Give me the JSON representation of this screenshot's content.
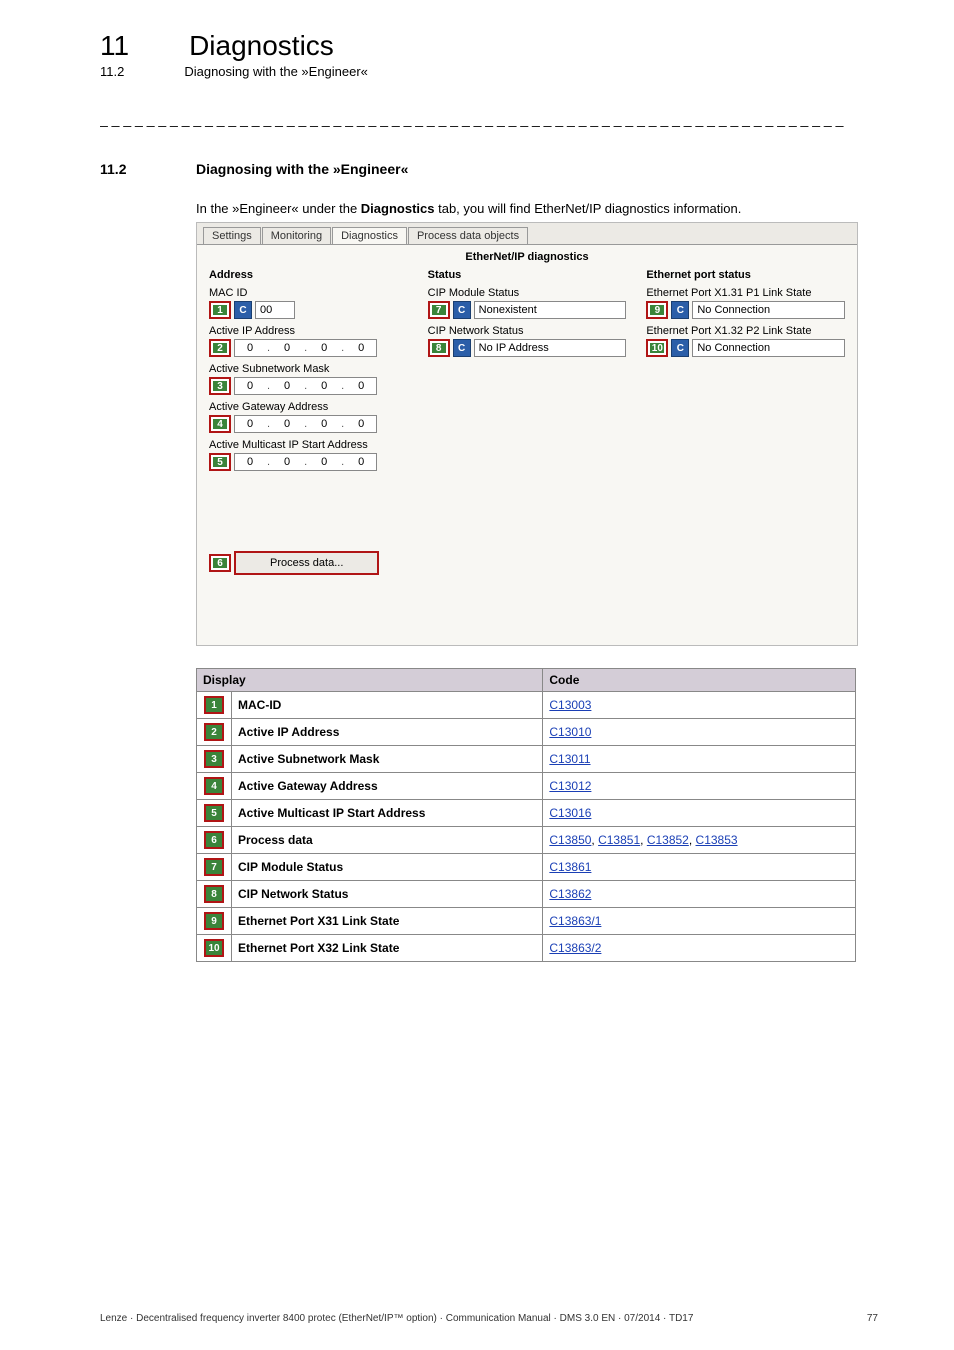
{
  "chapter": {
    "num": "11",
    "title": "Diagnostics"
  },
  "section": {
    "num": "11.2",
    "name": "Diagnosing with the »Engineer«"
  },
  "dashline": "_ _ _ _ _ _ _ _ _ _ _ _ _ _ _ _ _ _ _ _ _ _ _ _ _ _ _ _ _ _ _ _ _ _ _ _ _ _ _ _ _ _ _ _ _ _ _ _ _ _ _ _ _ _ _ _ _ _ _ _ _ _ _ _",
  "heading": {
    "num": "11.2",
    "text": "Diagnosing with the »Engineer«"
  },
  "intro": {
    "pre": "In the »Engineer« under the ",
    "bold": "Diagnostics",
    "post": " tab, you will find EtherNet/IP diagnostics information."
  },
  "shot": {
    "tabs": [
      "Settings",
      "Monitoring",
      "Diagnostics",
      "Process data objects"
    ],
    "active_tab_index": 2,
    "panel_title": "EtherNet/IP diagnostics",
    "c_badge": "C",
    "address": {
      "header": "Address",
      "mac_label": "MAC ID",
      "mac_val": "00",
      "ip_label": "Active IP Address",
      "sub_label": "Active Subnetwork Mask",
      "gw_label": "Active Gateway Address",
      "mc_label": "Active Multicast IP Start Address",
      "oct": "0"
    },
    "status": {
      "header": "Status",
      "cip_mod_label": "CIP Module Status",
      "cip_mod_val": "Nonexistent",
      "cip_net_label": "CIP Network Status",
      "cip_net_val": "No IP Address"
    },
    "port": {
      "header": "Ethernet port status",
      "p1_label": "Ethernet Port X1.31 P1 Link State",
      "p1_val": "No Connection",
      "p2_label": "Ethernet Port X1.32 P2 Link State",
      "p2_val": "No Connection"
    },
    "proc_btn": "Process data...",
    "callouts": {
      "1": "1",
      "2": "2",
      "3": "3",
      "4": "4",
      "5": "5",
      "6": "6",
      "7": "7",
      "8": "8",
      "9": "9",
      "10": "10"
    }
  },
  "table": {
    "headers": {
      "display": "Display",
      "code": "Code"
    },
    "rows": [
      {
        "n": "1",
        "display": "MAC-ID",
        "codes": [
          "C13003"
        ]
      },
      {
        "n": "2",
        "display": "Active IP Address",
        "codes": [
          "C13010"
        ]
      },
      {
        "n": "3",
        "display": "Active Subnetwork Mask",
        "codes": [
          "C13011"
        ]
      },
      {
        "n": "4",
        "display": "Active Gateway Address",
        "codes": [
          "C13012"
        ]
      },
      {
        "n": "5",
        "display": "Active Multicast IP Start Address",
        "codes": [
          "C13016"
        ]
      },
      {
        "n": "6",
        "display": "Process data",
        "codes": [
          "C13850",
          "C13851",
          "C13852",
          "C13853"
        ]
      },
      {
        "n": "7",
        "display": "CIP Module Status",
        "codes": [
          "C13861"
        ]
      },
      {
        "n": "8",
        "display": "CIP Network Status",
        "codes": [
          "C13862"
        ]
      },
      {
        "n": "9",
        "display": "Ethernet Port X31 Link State",
        "codes": [
          "C13863/1"
        ]
      },
      {
        "n": "10",
        "display": "Ethernet Port X32 Link State",
        "codes": [
          "C13863/2"
        ]
      }
    ]
  },
  "footer": {
    "left": "Lenze · Decentralised frequency inverter 8400 protec (EtherNet/IP™ option) · Communication Manual · DMS 3.0 EN · 07/2014 · TD17",
    "right": "77"
  }
}
